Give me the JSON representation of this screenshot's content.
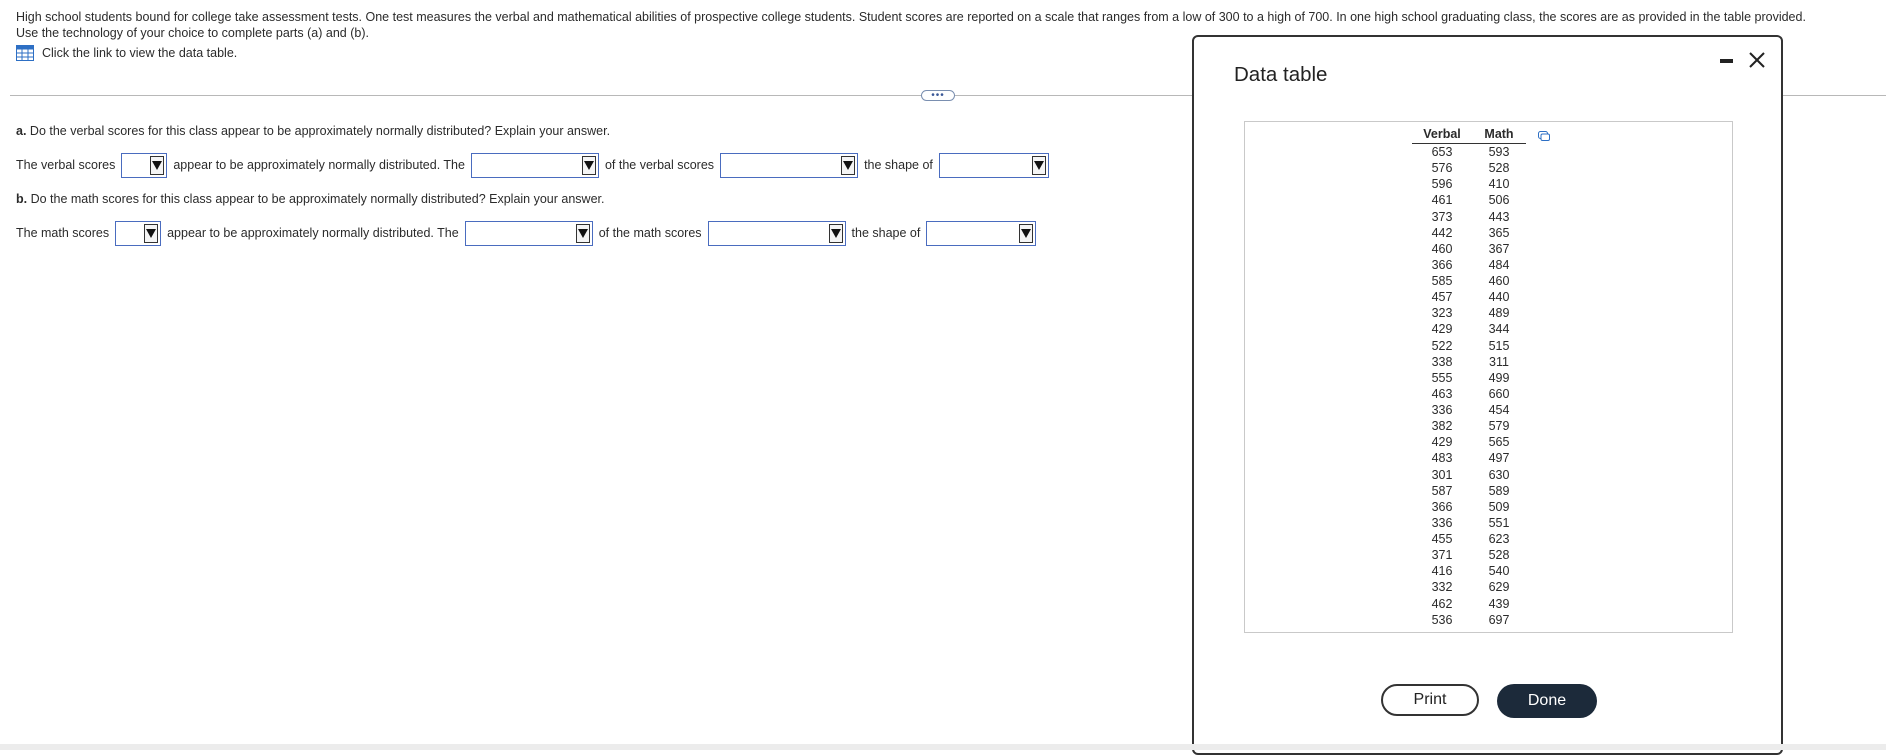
{
  "intro": {
    "line1": "High school students bound for college take assessment tests. One test measures the verbal and mathematical abilities of prospective college students. Student scores are reported on a scale that ranges from a low of 300 to a high of 700. In one high school graduating class, the scores are as provided in the table provided.",
    "line2": "Use the technology of your choice to complete parts (a) and (b).",
    "link_label": "Click the link to view the data table."
  },
  "question_a": {
    "prefix": "a.",
    "text": " Do the verbal scores for this class appear to be approximately normally distributed? Explain your answer.",
    "s1": "The verbal scores",
    "s2": "appear to be approximately normally distributed. The",
    "s3": "of the verbal scores",
    "s4": "the shape of"
  },
  "question_b": {
    "prefix": "b.",
    "text": " Do the math scores for this class appear to be approximately normally distributed? Explain your answer.",
    "s1": "The math scores",
    "s2": "appear to be approximately normally distributed. The",
    "s3": "of the math scores",
    "s4": "the shape of"
  },
  "modal": {
    "title": "Data table",
    "col_verbal": "Verbal",
    "col_math": "Math",
    "rows": [
      [
        "653",
        "593"
      ],
      [
        "576",
        "528"
      ],
      [
        "596",
        "410"
      ],
      [
        "461",
        "506"
      ],
      [
        "373",
        "443"
      ],
      [
        "442",
        "365"
      ],
      [
        "460",
        "367"
      ],
      [
        "366",
        "484"
      ],
      [
        "585",
        "460"
      ],
      [
        "457",
        "440"
      ],
      [
        "323",
        "489"
      ],
      [
        "429",
        "344"
      ],
      [
        "522",
        "515"
      ],
      [
        "338",
        "311"
      ],
      [
        "555",
        "499"
      ],
      [
        "463",
        "660"
      ],
      [
        "336",
        "454"
      ],
      [
        "382",
        "579"
      ],
      [
        "429",
        "565"
      ],
      [
        "483",
        "497"
      ],
      [
        "301",
        "630"
      ],
      [
        "587",
        "589"
      ],
      [
        "366",
        "509"
      ],
      [
        "336",
        "551"
      ],
      [
        "455",
        "623"
      ],
      [
        "371",
        "528"
      ],
      [
        "416",
        "540"
      ],
      [
        "332",
        "629"
      ],
      [
        "462",
        "439"
      ],
      [
        "536",
        "697"
      ]
    ],
    "print_label": "Print",
    "done_label": "Done"
  },
  "colors": {
    "accent_blue": "#4a6cbf",
    "done_bg": "#1c2a3a"
  }
}
